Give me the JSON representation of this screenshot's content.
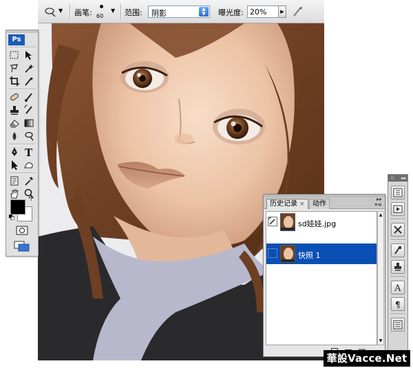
{
  "options_bar": {
    "brush_label": "画笔:",
    "brush_size": "60",
    "range_label": "范围:",
    "range_value": "阴影",
    "exposure_label": "曝光度:",
    "exposure_value": "20%"
  },
  "toolbox": {
    "logo": "Ps",
    "foreground_color": "#000000",
    "background_color": "#ffffff"
  },
  "history_panel": {
    "tabs": [
      {
        "label": "历史记录",
        "active": true
      },
      {
        "label": "动作",
        "active": false
      }
    ],
    "items": [
      {
        "name": "sd娃娃.jpg",
        "selected": false
      },
      {
        "name": "快照 1",
        "selected": true
      }
    ],
    "selection_color": "#0a4fb3"
  },
  "watermark": "華設Vacce.Net",
  "icons": {
    "tool_preset": "dodge-tool-icon",
    "airbrush": "airbrush-icon",
    "swap": "swap-colors-icon"
  }
}
